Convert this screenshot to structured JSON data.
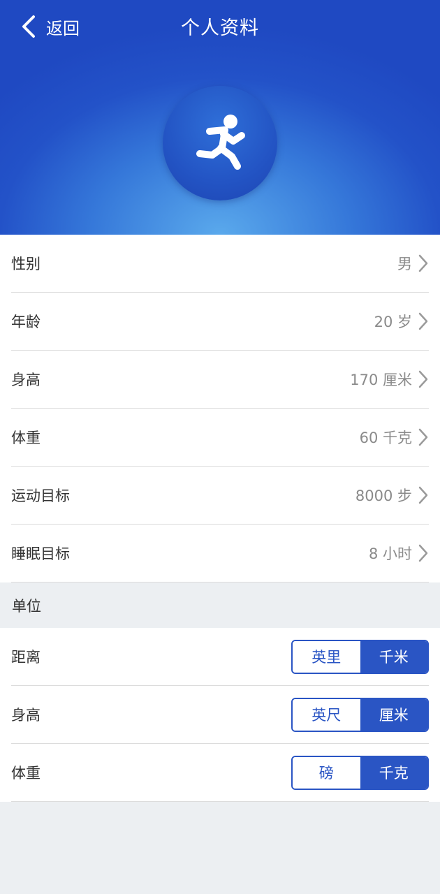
{
  "header": {
    "back_label": "返回",
    "title": "个人资料",
    "avatar_icon": "running-person-icon"
  },
  "profile": [
    {
      "label": "性别",
      "value": "男"
    },
    {
      "label": "年龄",
      "value": "20 岁"
    },
    {
      "label": "身高",
      "value": "170 厘米"
    },
    {
      "label": "体重",
      "value": "60 千克"
    },
    {
      "label": "运动目标",
      "value": "8000 步"
    },
    {
      "label": "睡眠目标",
      "value": "8 小时"
    }
  ],
  "units_section": {
    "title": "单位",
    "rows": [
      {
        "label": "距离",
        "options": [
          "英里",
          "千米"
        ],
        "selected": "千米"
      },
      {
        "label": "身高",
        "options": [
          "英尺",
          "厘米"
        ],
        "selected": "厘米"
      },
      {
        "label": "体重",
        "options": [
          "磅",
          "千克"
        ],
        "selected": "千克"
      }
    ]
  },
  "colors": {
    "accent": "#2a55c4",
    "header_top": "#1f49c2",
    "header_glow": "#5aa9ec",
    "background": "#eceff2"
  }
}
